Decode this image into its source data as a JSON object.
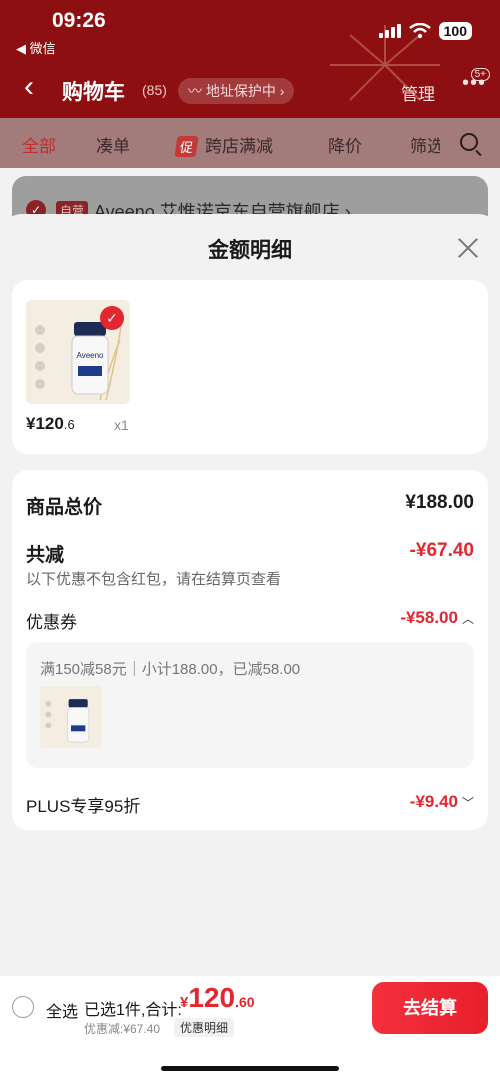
{
  "status_bar": {
    "time": "09:26",
    "back_app": "◀ 微信",
    "battery": "100"
  },
  "nav": {
    "title": "购物车",
    "count": "(85)",
    "protect_label": "地址保护中",
    "manage_label": "管理",
    "more_badge": "5+"
  },
  "tabs": [
    "全部",
    "凑单",
    "跨店满减",
    "降价",
    "筛选"
  ],
  "promo_tag": "促",
  "store": {
    "tag": "自营",
    "name": "Aveeno 艾惟诺京东自营旗舰店 ›"
  },
  "sheet": {
    "title": "金额明细",
    "product": {
      "price_main": "¥120",
      "price_decimal": ".6",
      "quantity": "x1",
      "brand": "Aveeno"
    },
    "total_label": "商品总价",
    "total_value": "¥188.00",
    "discount_label": "共减",
    "discount_value": "-¥67.40",
    "note": "以下优惠不包含红包，请在结算页查看",
    "coupon_label": "优惠券",
    "coupon_value": "-¥58.00",
    "coupon_detail": "满150减58元｜小计188.00，已减58.00",
    "plus_label": "PLUS专享95折",
    "plus_value": "-¥9.40"
  },
  "bottom": {
    "select_all": "全选",
    "summary": "已选1件,合计:",
    "total_currency": "¥",
    "total_int": "120",
    "total_dec": ".60",
    "discount": "优惠减:¥67.40",
    "detail_link": "优惠明细",
    "checkout": "去结算"
  },
  "colors": {
    "accent": "#e3262f",
    "header_bg": "#8e0f12"
  }
}
